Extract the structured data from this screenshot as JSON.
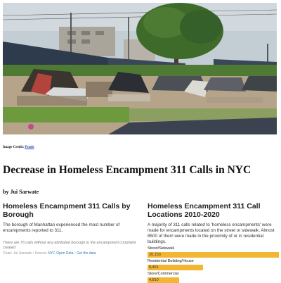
{
  "hero": {
    "image_credit_prefix": "Image Credit: ",
    "image_credit_link": "Pexels"
  },
  "article": {
    "title": "Decrease in Homeless Encampment 311 Calls in NYC",
    "byline": "by Jui Sarwate"
  },
  "left_panel": {
    "heading": "Homeless Encampment 311 Calls by Borough",
    "description": "The borough of Manhattan experienced the most number of encampments reported to 311.",
    "note": "There are 76 calls without any attributed borough to the encampment complaint created",
    "source_prefix": "Chart: Jui Sarwate • Source: ",
    "source_link": "NYC Open Data",
    "source_sep": " • ",
    "data_link": "Get the data"
  },
  "right_panel": {
    "heading": "Homeless Encampment 311 Call Locations 2010-2020",
    "description": "A majority of 311 calls related to 'homeless encampments' were made for encampments located on the street or sidewalk. Almost 8500 of them were made in the proximity of or in residential buildings."
  },
  "chart_data": {
    "type": "bar",
    "categories": [
      "Street/Sidewalk",
      "Residential Building/House",
      "Store/Commercial"
    ],
    "values": [
      20153,
      8491,
      4810
    ],
    "value_labels": [
      "20,153",
      "8,491",
      "4,810"
    ],
    "bar_color": "#f2b632"
  }
}
